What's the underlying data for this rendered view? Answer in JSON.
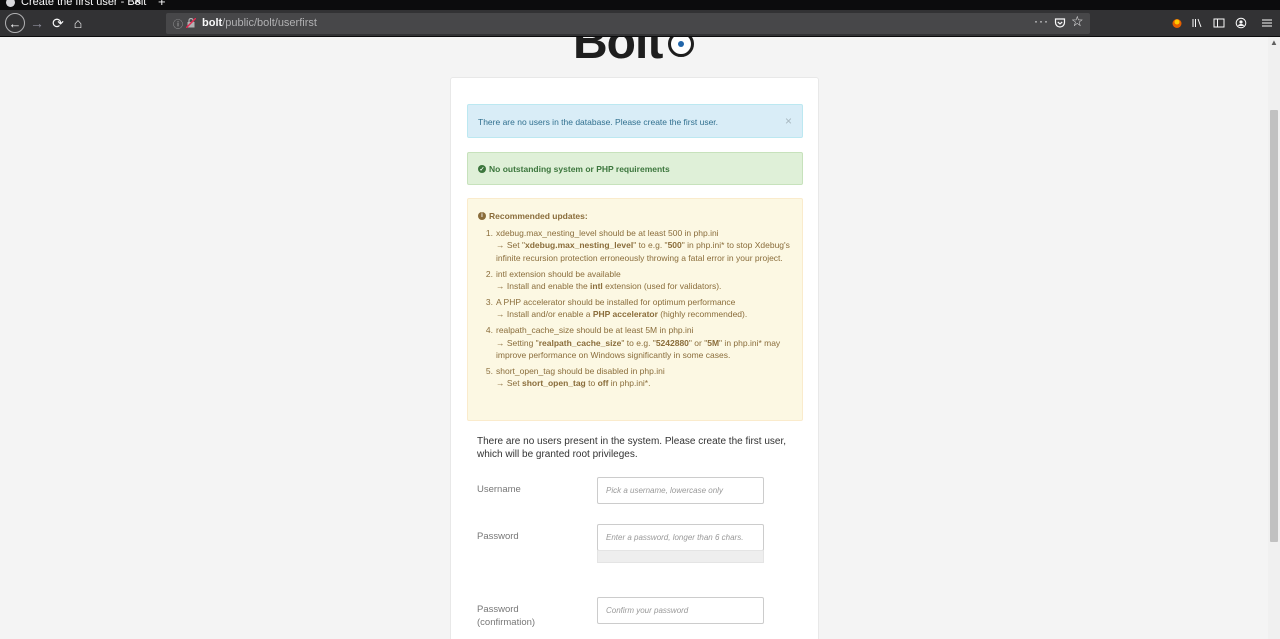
{
  "browser": {
    "tab_title": "Create the first user - Bolt",
    "url_host": "bolt",
    "url_path": "/public/bolt/userfirst"
  },
  "alerts": {
    "info": "There are no users in the database. Please create the first user.",
    "info_close": "×",
    "success": "No outstanding system or PHP requirements",
    "warning_title": "Recommended updates:",
    "warning_items": [
      {
        "num": "1.",
        "line1": "xdebug.max_nesting_level should be at least 500 in php.ini",
        "pre": "→ Set \"",
        "b1": "xdebug.max_nesting_level",
        "mid1": "\" to e.g. \"",
        "b2": "500",
        "post": "\" in php.ini* to stop Xdebug's infinite recursion protection erroneously throwing a fatal error in your project."
      },
      {
        "num": "2.",
        "line1": "intl extension should be available",
        "pre": "→ Install and enable the ",
        "b1": "intl",
        "post": " extension (used for validators)."
      },
      {
        "num": "3.",
        "line1": "A PHP accelerator should be installed for optimum performance",
        "pre": "→ Install and/or enable a ",
        "b1": "PHP accelerator",
        "post": " (highly recommended)."
      },
      {
        "num": "4.",
        "line1": "realpath_cache_size should be at least 5M in php.ini",
        "pre": "→ Setting \"",
        "b1": "realpath_cache_size",
        "mid1": "\" to e.g. \"",
        "b2": "5242880",
        "mid2": "\" or \"",
        "b3": "5M",
        "post": "\" in php.ini* may improve performance on Windows significantly in some cases."
      },
      {
        "num": "5.",
        "line1": "short_open_tag should be disabled in php.ini",
        "pre": "→ Set ",
        "b1": "short_open_tag",
        "mid1": " to ",
        "b2": "off",
        "post": " in php.ini*."
      }
    ]
  },
  "form": {
    "intro": "There are no users present in the system. Please create the first user, which will be granted root privileges.",
    "username_label": "Username",
    "username_placeholder": "Pick a username, lowercase only",
    "password_label": "Password",
    "password_placeholder": "Enter a password, longer than 6 chars.",
    "confirm_label": "Password (confirmation)",
    "confirm_placeholder": "Confirm your password"
  },
  "colors": {
    "info_bg": "#d9edf7",
    "success_bg": "#dff0d8",
    "warning_bg": "#fcf8e3",
    "chrome_dark": "#323234"
  }
}
